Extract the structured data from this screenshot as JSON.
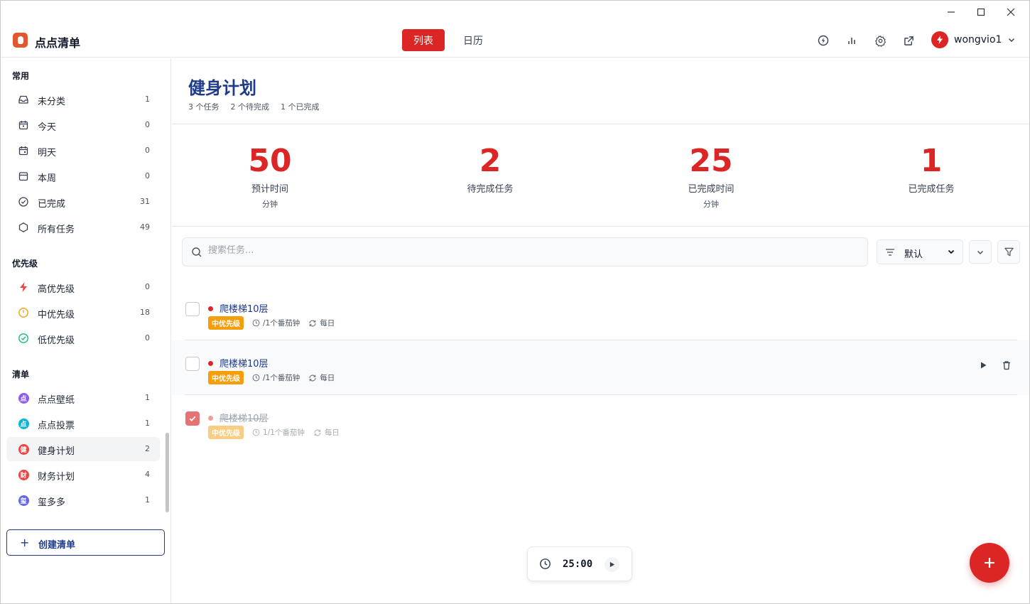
{
  "app": {
    "name": "点点清单"
  },
  "window": {
    "minimize": "—",
    "maximize": "☐",
    "close": "✕"
  },
  "header": {
    "tabs": [
      {
        "label": "列表",
        "active": true
      },
      {
        "label": "日历",
        "active": false
      }
    ],
    "icons": [
      "lightning-circle-icon",
      "bar-chart-icon",
      "gear-icon",
      "external-link-icon"
    ],
    "user": {
      "name": "wongvio1"
    }
  },
  "sidebar": {
    "sections": {
      "common": "常用",
      "priority": "优先级",
      "lists": "清单"
    },
    "common_items": [
      {
        "label": "未分类",
        "count": "1",
        "icon": "inbox-icon"
      },
      {
        "label": "今天",
        "count": "0",
        "icon": "calendar-today-icon"
      },
      {
        "label": "明天",
        "count": "0",
        "icon": "calendar-tomorrow-icon"
      },
      {
        "label": "本周",
        "count": "0",
        "icon": "calendar-week-icon"
      },
      {
        "label": "已完成",
        "count": "31",
        "icon": "check-circle-icon"
      },
      {
        "label": "所有任务",
        "count": "49",
        "icon": "hexagon-icon"
      }
    ],
    "priority_items": [
      {
        "label": "高优先级",
        "count": "0",
        "icon": "lightning-icon",
        "color": "#ef4444"
      },
      {
        "label": "中优先级",
        "count": "18",
        "icon": "clock-circle-icon",
        "color": "#f59e0b"
      },
      {
        "label": "低优先级",
        "count": "0",
        "icon": "check-circle-icon",
        "color": "#10b981"
      }
    ],
    "list_items": [
      {
        "label": "点点壁纸",
        "count": "1",
        "badge": "点",
        "color": "#8b5cf6"
      },
      {
        "label": "点点投票",
        "count": "1",
        "badge": "点",
        "color": "#06b6d4"
      },
      {
        "label": "健身计划",
        "count": "2",
        "badge": "健",
        "color": "#ef4444",
        "active": true
      },
      {
        "label": "财务计划",
        "count": "4",
        "badge": "财",
        "color": "#ef4444"
      },
      {
        "label": "玺多多",
        "count": "1",
        "badge": "玺",
        "color": "#6366f1"
      }
    ],
    "create_label": "创建清单"
  },
  "main": {
    "title": "健身计划",
    "summary": [
      "3 个任务",
      "2 个待完成",
      "1 个已完成"
    ],
    "stats": [
      {
        "value": "50",
        "label": "预计时间",
        "unit": "分钟"
      },
      {
        "value": "2",
        "label": "待完成任务",
        "unit": ""
      },
      {
        "value": "25",
        "label": "已完成时间",
        "unit": "分钟"
      },
      {
        "value": "1",
        "label": "已完成任务",
        "unit": ""
      }
    ],
    "search": {
      "placeholder": "搜索任务...",
      "value": ""
    },
    "sort": {
      "label": "默认"
    },
    "tasks": [
      {
        "title": "爬楼梯10层",
        "priority": "中优先级",
        "pomodoro": "/1个番茄钟",
        "repeat": "每日",
        "done": false
      },
      {
        "title": "爬楼梯10层",
        "priority": "中优先级",
        "pomodoro": "/1个番茄钟",
        "repeat": "每日",
        "done": false
      },
      {
        "title": "爬楼梯10层",
        "priority": "中优先级",
        "pomodoro": "1/1个番茄钟",
        "repeat": "每日",
        "done": true
      }
    ],
    "timer": {
      "time": "25:00"
    }
  },
  "colors": {
    "accent": "#dc2626",
    "title": "#1e3a8a",
    "priority_medium": "#f59e0b"
  }
}
